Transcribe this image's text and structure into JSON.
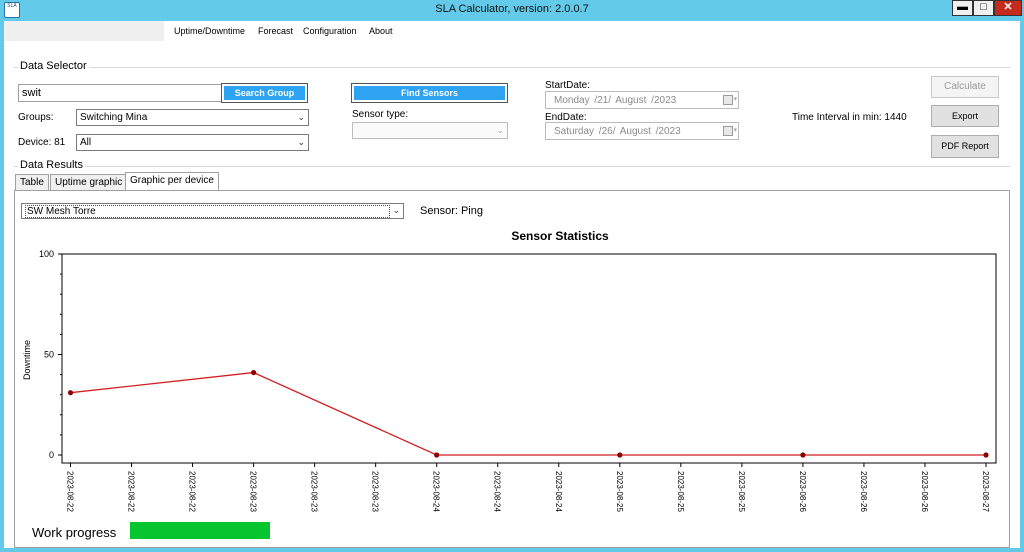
{
  "window": {
    "title": "SLA Calculator, version: 2.0.0.7",
    "icon_name": "sla-app-icon",
    "icon_text": "SLA",
    "minimize": "▬",
    "maximize": "□",
    "close": "✕"
  },
  "menu": {
    "items": [
      "Uptime/Downtime",
      "Forecast",
      "Configuration",
      "About"
    ]
  },
  "data_selector": {
    "group_title": "Data Selector",
    "search_value": "swit",
    "search_group_label": "Search Group",
    "groups_label": "Groups:",
    "groups_value": "Switching Mina",
    "device_label": "Device: 81",
    "device_value": "All",
    "find_sensors_label": "Find Sensors",
    "sensor_type_label": "Sensor type:",
    "sensor_type_value": "",
    "start_date_label": "StartDate:",
    "start_date_value": "Monday  /21/  August  /2023",
    "end_date_label": "EndDate:",
    "end_date_value": "Saturday  /26/  August  /2023",
    "time_interval": "Time Interval in min: 1440",
    "calculate_label": "Calculate",
    "export_label": "Export",
    "pdf_report_label": "PDF Report"
  },
  "results": {
    "group_title": "Data Results",
    "tabs": [
      "Table",
      "Uptime graphic",
      "Graphic per device"
    ],
    "active_tab": 2,
    "device_select_value": "SW Mesh Torre",
    "sensor_label": "Sensor: Ping"
  },
  "chart_data": {
    "type": "line",
    "title": "Sensor Statistics",
    "xlabel": "",
    "ylabel": "Downtime",
    "ylim": [
      0,
      100
    ],
    "yticks": [
      0,
      50,
      100
    ],
    "x_tick_labels": [
      "2023-08-22",
      "2023-08-22",
      "2023-08-22",
      "2023-08-23",
      "2023-08-23",
      "2023-08-23",
      "2023-08-24",
      "2023-08-24",
      "2023-08-24",
      "2023-08-25",
      "2023-08-25",
      "2023-08-25",
      "2023-08-26",
      "2023-08-26",
      "2023-08-26",
      "2023-08-27"
    ],
    "grid": false,
    "legend": "none",
    "line_color": "#d31f1f",
    "marker_color": "#8b0000",
    "series": [
      {
        "x": [
          "2023-08-22",
          "2023-08-23",
          "2023-08-24",
          "2023-08-25",
          "2023-08-26",
          "2023-08-27"
        ],
        "values": [
          31,
          41,
          0,
          0,
          0,
          0
        ]
      }
    ]
  },
  "progress": {
    "label": "Work progress",
    "value_fraction": 1.0,
    "color": "#06c52f"
  }
}
